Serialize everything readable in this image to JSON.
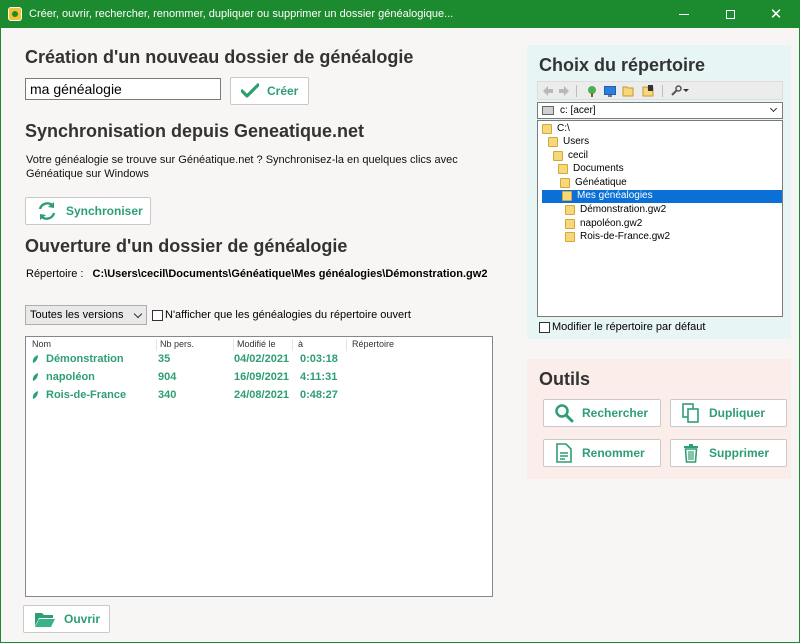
{
  "window": {
    "title": "Créer, ouvrir, rechercher, renommer, dupliquer ou supprimer un dossier généalogique...",
    "minimize": "–",
    "maximize": "□",
    "close": "✕"
  },
  "create": {
    "heading": "Création d'un nouveau dossier de généalogie",
    "name_value": "ma généalogie",
    "create_button": "Créer"
  },
  "sync": {
    "heading": "Synchronisation depuis Geneatique.net",
    "description": "Votre généalogie se trouve sur Généatique.net ? Synchronisez-la en quelques clics avec Généatique sur Windows",
    "sync_button": "Synchroniser"
  },
  "open": {
    "heading": "Ouverture d'un dossier de généalogie",
    "repo_label": "Répertoire :",
    "repo_path": "C:\\Users\\cecil\\Documents\\Généatique\\Mes généalogies\\Démonstration.gw2",
    "version_select": "Toutes les versions",
    "filter_checkbox_label": "N'afficher que les généalogies du répertoire ouvert",
    "columns": [
      "Nom",
      "Nb pers.",
      "Modifié le",
      "à",
      "Répertoire"
    ],
    "rows": [
      {
        "name": "Démonstration",
        "count": "35",
        "date": "04/02/2021",
        "time": "0:03:18"
      },
      {
        "name": "napoléon",
        "count": "904",
        "date": "16/09/2021",
        "time": "4:11:31"
      },
      {
        "name": "Rois-de-France",
        "count": "340",
        "date": "24/08/2021",
        "time": "0:48:27"
      }
    ],
    "open_button": "Ouvrir"
  },
  "directory": {
    "heading": "Choix du répertoire",
    "drive": "c: [acer]",
    "tree": [
      {
        "label": "C:\\",
        "level": 0
      },
      {
        "label": "Users",
        "level": 1
      },
      {
        "label": "cecil",
        "level": 2
      },
      {
        "label": "Documents",
        "level": 3
      },
      {
        "label": "Généatique",
        "level": 4
      },
      {
        "label": "Mes généalogies",
        "level": 5,
        "selected": true
      },
      {
        "label": "Démonstration.gw2",
        "level": 6
      },
      {
        "label": "napoléon.gw2",
        "level": 6
      },
      {
        "label": "Rois-de-France.gw2",
        "level": 6
      }
    ],
    "default_checkbox_label": "Modifier le répertoire par défaut"
  },
  "tools": {
    "heading": "Outils",
    "search_button": "Rechercher",
    "duplicate_button": "Dupliquer",
    "rename_button": "Renommer",
    "delete_button": "Supprimer"
  },
  "colors": {
    "titlebar": "#1c8a2e",
    "accent_text": "#2e9e73",
    "selection": "#0a6fd6",
    "directory_panel": "#e8f5f5",
    "tools_panel": "#fbeeea"
  }
}
